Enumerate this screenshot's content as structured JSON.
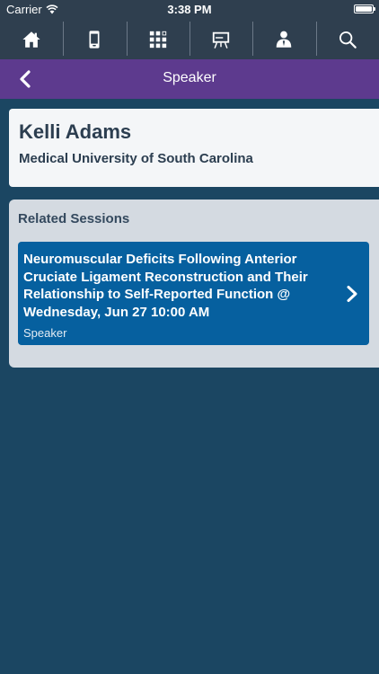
{
  "status_bar": {
    "carrier": "Carrier",
    "time": "3:38 PM",
    "battery_level": 1.0
  },
  "toolbar": {
    "buttons": [
      {
        "name": "home",
        "icon": "home-icon"
      },
      {
        "name": "mobile",
        "icon": "mobile-device-icon"
      },
      {
        "name": "grid",
        "icon": "grid-icon"
      },
      {
        "name": "presentation",
        "icon": "presentation-easel-icon"
      },
      {
        "name": "speaker",
        "icon": "person-icon"
      },
      {
        "name": "search",
        "icon": "search-icon"
      }
    ]
  },
  "nav": {
    "title": "Speaker",
    "back_icon": "chevron-left-icon"
  },
  "speaker": {
    "name": "Kelli Adams",
    "organization": "Medical University of South Carolina"
  },
  "related": {
    "heading": "Related Sessions",
    "sessions": [
      {
        "title": "Neuromuscular Deficits Following Anterior Cruciate Ligament Reconstruction and Their Relationship to Self-Reported Function @ Wednesday, Jun 27 10:00 AM",
        "role": "Speaker",
        "chevron_icon": "chevron-right-icon"
      }
    ]
  },
  "colors": {
    "background": "#1b4662",
    "toolbar": "#2f3f4f",
    "nav_bar": "#5d3a8e",
    "session_item": "#06609f",
    "card": "#f4f6f8",
    "related_card": "#d4dae1"
  }
}
